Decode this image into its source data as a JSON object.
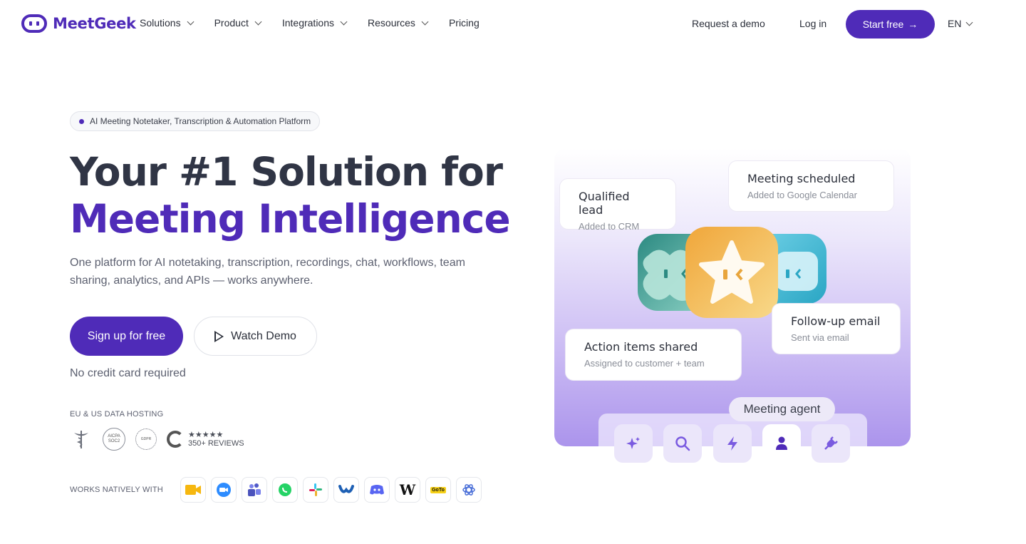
{
  "brand": {
    "name": "MeetGeek",
    "accent": "#4f2bb8"
  },
  "nav": {
    "items": [
      {
        "label": "Solutions",
        "has_dropdown": true
      },
      {
        "label": "Product",
        "has_dropdown": true
      },
      {
        "label": "Integrations",
        "has_dropdown": true
      },
      {
        "label": "Resources",
        "has_dropdown": true
      },
      {
        "label": "Pricing",
        "has_dropdown": false
      }
    ],
    "request_demo": "Request a demo",
    "login": "Log in",
    "start_free": "Start free",
    "start_free_arrow": "→",
    "language": "EN"
  },
  "hero": {
    "badge": "AI Meeting Notetaker, Transcription & Automation Platform",
    "title_line1": "Your #1 Solution for",
    "title_line2": "Meeting Intelligence",
    "subtitle": "One platform for AI notetaking, transcription, recordings, chat, workflows, team sharing, analytics, and APIs — works anywhere.",
    "signup_button": "Sign up for free",
    "watch_demo_button": "Watch Demo",
    "no_credit_card": "No credit card required",
    "hosting_label": "EU & US DATA HOSTING",
    "certs": {
      "aicpa_line1": "AICPA",
      "aicpa_line2": "SOC2",
      "gdpr": "GDPR",
      "g2_stars": "★★★★★",
      "g2_reviews": "350+ REVIEWS"
    },
    "works_with_label": "WORKS NATIVELY WITH",
    "integrations": [
      {
        "name": "google-meet",
        "icon": "google-meet-icon"
      },
      {
        "name": "zoom",
        "icon": "zoom-icon"
      },
      {
        "name": "microsoft-teams",
        "icon": "teams-icon"
      },
      {
        "name": "whatsapp",
        "icon": "whatsapp-icon"
      },
      {
        "name": "slack",
        "icon": "slack-icon"
      },
      {
        "name": "webex",
        "icon": "webex-icon"
      },
      {
        "name": "discord",
        "icon": "discord-icon"
      },
      {
        "name": "wix",
        "icon": "wix-icon",
        "text": "W"
      },
      {
        "name": "goto",
        "icon": "goto-icon",
        "text": "GoTo"
      },
      {
        "name": "openai",
        "icon": "openai-icon"
      }
    ]
  },
  "illustration": {
    "cards": {
      "qualified_title": "Qualified lead",
      "qualified_sub": "Added to CRM",
      "scheduled_title": "Meeting scheduled",
      "scheduled_sub": "Added to Google Calendar",
      "actions_title": "Action items shared",
      "actions_sub": "Assigned to customer + team",
      "followup_title": "Follow-up email",
      "followup_sub": "Sent via email"
    },
    "agent_label": "Meeting agent",
    "tools": [
      {
        "icon": "sparkle-icon",
        "active": false
      },
      {
        "icon": "search-icon",
        "active": false
      },
      {
        "icon": "lightning-icon",
        "active": false
      },
      {
        "icon": "person-icon",
        "active": true
      },
      {
        "icon": "plug-icon",
        "active": false
      }
    ]
  }
}
